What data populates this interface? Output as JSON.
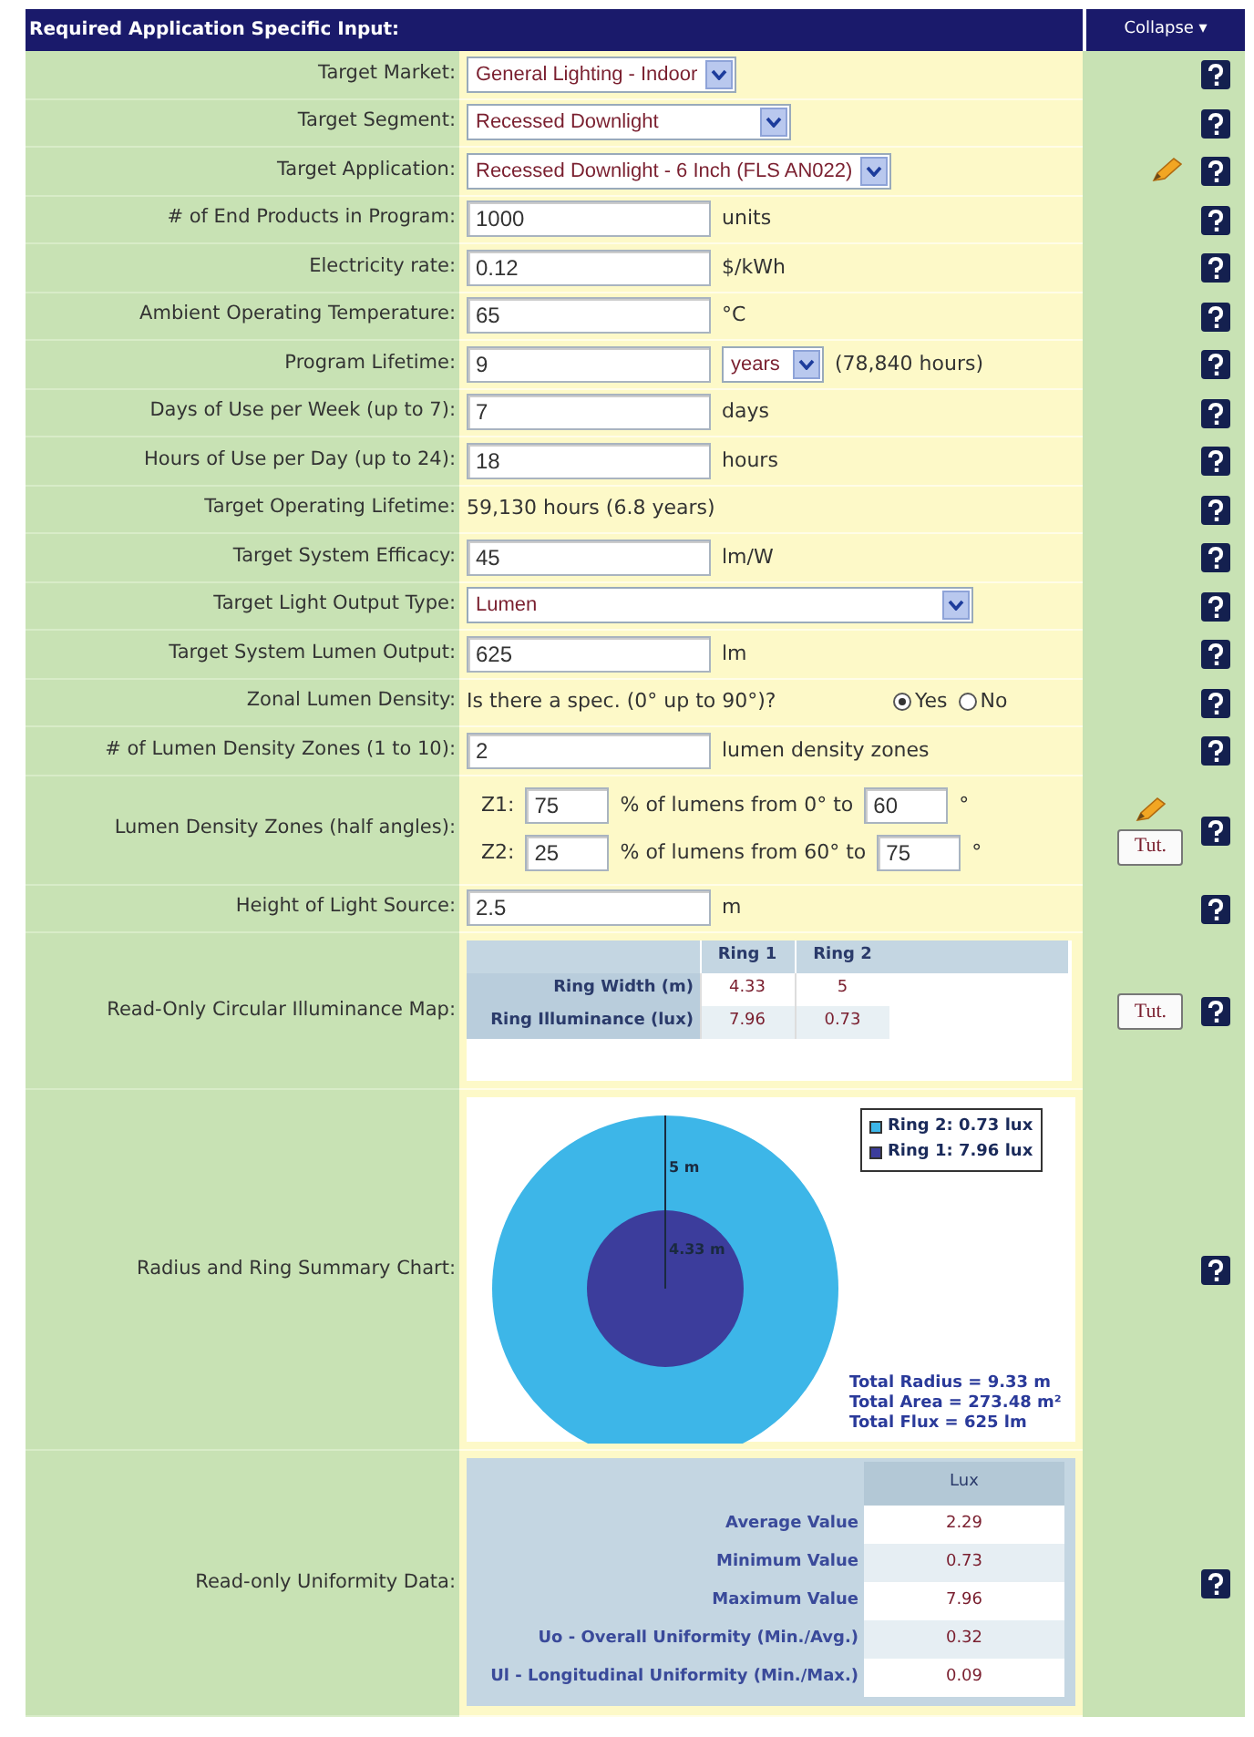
{
  "header": {
    "title": "Required Application Specific Input:",
    "collapse": "Collapse ▾"
  },
  "rows": [
    {
      "kind": "select",
      "label": "Target Market:",
      "value": "General Lighting - Indoor"
    },
    {
      "kind": "select",
      "label": "Target Segment:",
      "value": "Recessed Downlight"
    },
    {
      "kind": "select",
      "label": "Target Application:",
      "value": "Recessed Downlight - 6 Inch (FLS AN022)",
      "tool_icon": true
    },
    {
      "kind": "input",
      "label": "# of End Products in Program:",
      "value": "1000",
      "unit": "units"
    },
    {
      "kind": "input",
      "label": "Electricity rate:",
      "value": "0.12",
      "unit": "$/kWh"
    },
    {
      "kind": "input",
      "label": "Ambient Operating Temperature:",
      "value": "65",
      "unit": "°C"
    },
    {
      "kind": "input_select",
      "label": "Program Lifetime:",
      "value": "9",
      "select": "years",
      "note": "(78,840 hours)"
    },
    {
      "kind": "input",
      "label": "Days of Use per Week (up to 7):",
      "value": "7",
      "unit": "days"
    },
    {
      "kind": "input",
      "label": "Hours of Use per Day (up to 24):",
      "value": "18",
      "unit": "hours"
    },
    {
      "kind": "readonly",
      "label": "Target Operating Lifetime:",
      "value": "59,130 hours (6.8 years)"
    },
    {
      "kind": "input",
      "label": "Target System Efficacy:",
      "value": "45",
      "unit": "lm/W"
    },
    {
      "kind": "select",
      "label": "Target Light Output Type:",
      "value": "Lumen"
    },
    {
      "kind": "input",
      "label": "Target System Lumen Output:",
      "value": "625",
      "unit": "lm"
    },
    {
      "kind": "radio",
      "label": "Zonal Lumen Density:",
      "question": "Is there a spec. (0° up to 90°)?",
      "options": [
        {
          "label": "Yes",
          "selected": true
        },
        {
          "label": "No",
          "selected": false
        }
      ]
    },
    {
      "kind": "input",
      "label": "# of Lumen Density Zones (1 to 10):",
      "value": "2",
      "unit": "lumen density zones"
    },
    {
      "kind": "zones",
      "label": "Lumen Density Zones (half angles):",
      "tool_icon": true,
      "tut": "Tut.",
      "zones": [
        {
          "name": "Z1:",
          "percent": "75",
          "text": "% of lumens from 0° to",
          "angle": "60",
          "unit": "°"
        },
        {
          "name": "Z2:",
          "percent": "25",
          "text": "% of lumens from 60° to",
          "angle": "75",
          "unit": "°"
        }
      ]
    },
    {
      "kind": "input",
      "label": "Height of Light Source:",
      "value": "2.5",
      "unit": "m"
    },
    {
      "kind": "map",
      "label": "Read-Only Circular Illuminance Map:",
      "tut": "Tut.",
      "columns": [
        "Ring 1",
        "Ring 2"
      ],
      "table_rows": [
        {
          "label": "Ring Width (m)",
          "values": [
            "4.33",
            "5"
          ]
        },
        {
          "label": "Ring Illuminance (lux)",
          "values": [
            "7.96",
            "0.73"
          ]
        }
      ]
    },
    {
      "kind": "chart",
      "label": "Radius and Ring Summary Chart:",
      "outer_label": "5 m",
      "inner_label": "4.33 m",
      "legend": [
        {
          "label": "Ring 2: 0.73 lux",
          "color": "#3db6e8"
        },
        {
          "label": "Ring 1: 7.96 lux",
          "color": "#3c3d9c"
        }
      ],
      "totals": [
        "Total Radius = 9.33 m",
        "Total Area = 273.48 m²",
        "Total Flux = 625 lm"
      ]
    },
    {
      "kind": "uniformity",
      "label": "Read-only Uniformity Data:",
      "column": "Lux",
      "table_rows": [
        {
          "label": "Average Value",
          "value": "2.29"
        },
        {
          "label": "Minimum Value",
          "value": "0.73"
        },
        {
          "label": "Maximum Value",
          "value": "7.96"
        },
        {
          "label": "Uo - Overall Uniformity (Min./Avg.)",
          "value": "0.32"
        },
        {
          "label": "Ul - Longitudinal Uniformity (Min./Max.)",
          "value": "0.09"
        }
      ]
    }
  ]
}
